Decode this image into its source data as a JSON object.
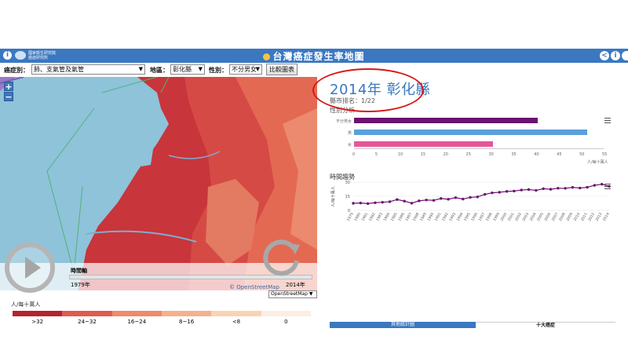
{
  "app": {
    "title": "台灣癌症發生率地圖",
    "org_name": "國家衛生研究院\n癌症研究所",
    "colors": {
      "header_bg": "#3b78c0",
      "highlight_ellipse": "#d51a1a",
      "female_bar": "#e8559a",
      "male_bar": "#5aa0dc",
      "total_bar": "#6b1470",
      "trend_line": "#6b1470"
    }
  },
  "header": {
    "info_left": "i",
    "icons": [
      "share-icon",
      "info-icon",
      "help-icon"
    ],
    "icon_glyphs": [
      "<",
      "i",
      "?"
    ]
  },
  "filters": {
    "cancer_label": "癌症別：",
    "cancer_value": "肺、支氣管及氣管",
    "region_label": "地區：",
    "region_value": "彰化縣",
    "sex_label": "性別：",
    "sex_value": "不分男女",
    "compare_button": "比較圖表"
  },
  "map": {
    "zoom_in": "+",
    "zoom_out": "−",
    "timeline_label": "時間軸",
    "year_start": "1979年",
    "year_end": "2014年",
    "attribution": "© OpenStreetMap",
    "basemap_select": "OpenStreetMap ▼"
  },
  "legend": {
    "title": "人/每十萬人",
    "classes": [
      {
        "label": ">32",
        "color": "#b3242c"
      },
      {
        "label": "24~32",
        "color": "#e05a4f"
      },
      {
        "label": "16~24",
        "color": "#f08a6a"
      },
      {
        "label": "8~16",
        "color": "#f6b08d"
      },
      {
        "label": "<8",
        "color": "#fbd3b4"
      },
      {
        "label": "0",
        "color": "#fdeee2"
      }
    ]
  },
  "summary": {
    "title": "2014年 彰化縣",
    "rank": "縣市排名：1/22",
    "gender_section": "性別分析"
  },
  "chart_data": [
    {
      "type": "bar",
      "categories": [
        "不分男女",
        "男",
        "女"
      ],
      "values": [
        40.5,
        51.3,
        30.6
      ],
      "colors": [
        "#6b1470",
        "#5aa0dc",
        "#e8559a"
      ],
      "xlim": [
        0,
        55
      ],
      "xticks": [
        "0",
        "5",
        "10",
        "15",
        "20",
        "25",
        "30",
        "35",
        "40",
        "45",
        "50",
        "55"
      ],
      "xlabel": "人/每十萬人",
      "orientation": "horizontal"
    },
    {
      "type": "line",
      "title": "時間趨勢",
      "ylabel": "人/每十萬人",
      "ylim": [
        0,
        30
      ],
      "yticks": [
        "0",
        "15",
        "30"
      ],
      "x": [
        "1979",
        "1980",
        "1981",
        "1982",
        "1983",
        "1984",
        "1985",
        "1986",
        "1987",
        "1988",
        "1989",
        "1990",
        "1991",
        "1992",
        "1993",
        "1994",
        "1995",
        "1996",
        "1997",
        "1998",
        "1999",
        "2000",
        "2001",
        "2002",
        "2003",
        "2004",
        "2005",
        "2006",
        "2007",
        "2008",
        "2009",
        "2010",
        "2011",
        "2012",
        "2013",
        "2014"
      ],
      "values": [
        7.5,
        7.8,
        7.2,
        8.1,
        8.6,
        9.2,
        11.5,
        9.8,
        7.6,
        10.1,
        11.0,
        10.6,
        12.6,
        11.8,
        13.5,
        12.0,
        13.8,
        14.3,
        17.0,
        18.6,
        19.2,
        20.1,
        20.5,
        21.6,
        22.1,
        21.2,
        23.0,
        22.4,
        23.5,
        23.4,
        24.4,
        23.7,
        24.5,
        26.6,
        27.8,
        25.5
      ]
    }
  ],
  "bottom_tabs": {
    "left": "其他統計圖",
    "right": "十大癌症"
  }
}
